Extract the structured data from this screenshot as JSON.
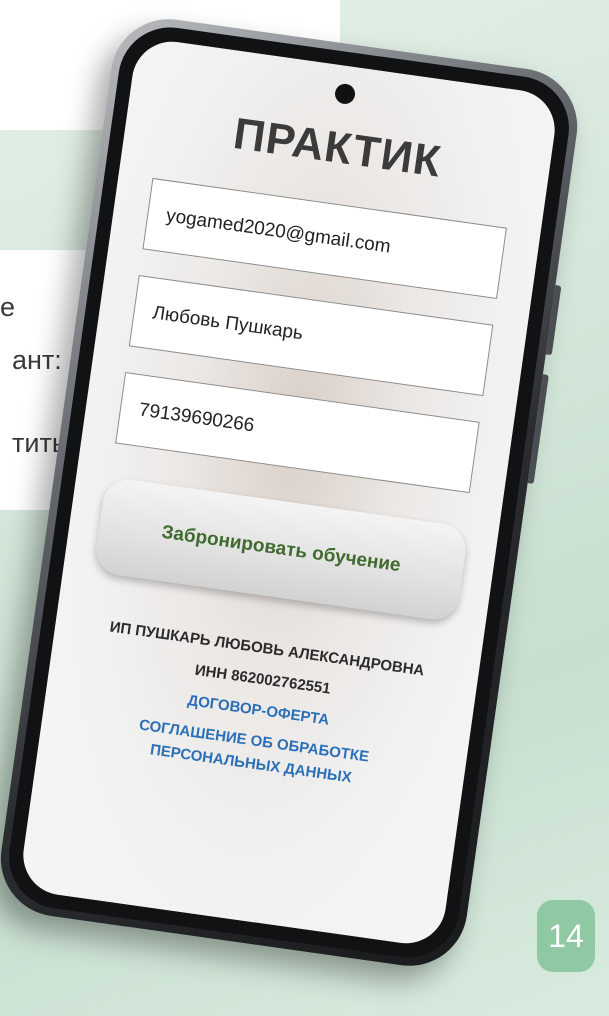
{
  "slide": {
    "text_fragments": [
      "е",
      "ант:",
      "тить"
    ],
    "page_number": "14",
    "accent_color": "#8fc9a3"
  },
  "app": {
    "title": "ПРАКТИК",
    "form": {
      "email_value": "yogamed2020@gmail.com",
      "name_value": "Любовь Пушкарь",
      "phone_value": "79139690266"
    },
    "book_button_label": "Забронировать обучение",
    "book_button_color": "#3f6b2f",
    "footer": {
      "company": "ИП ПУШКАРЬ ЛЮБОВЬ АЛЕКСАНДРОВНА",
      "inn": "ИНН 862002762551",
      "offer_link": "ДОГОВОР-ОФЕРТА",
      "privacy_link_line1": "СОГЛАШЕНИЕ ОБ ОБРАБОТКЕ",
      "privacy_link_line2": "ПЕРСОНАЛЬНЫХ ДАННЫХ",
      "link_color": "#2a6fb8"
    }
  }
}
